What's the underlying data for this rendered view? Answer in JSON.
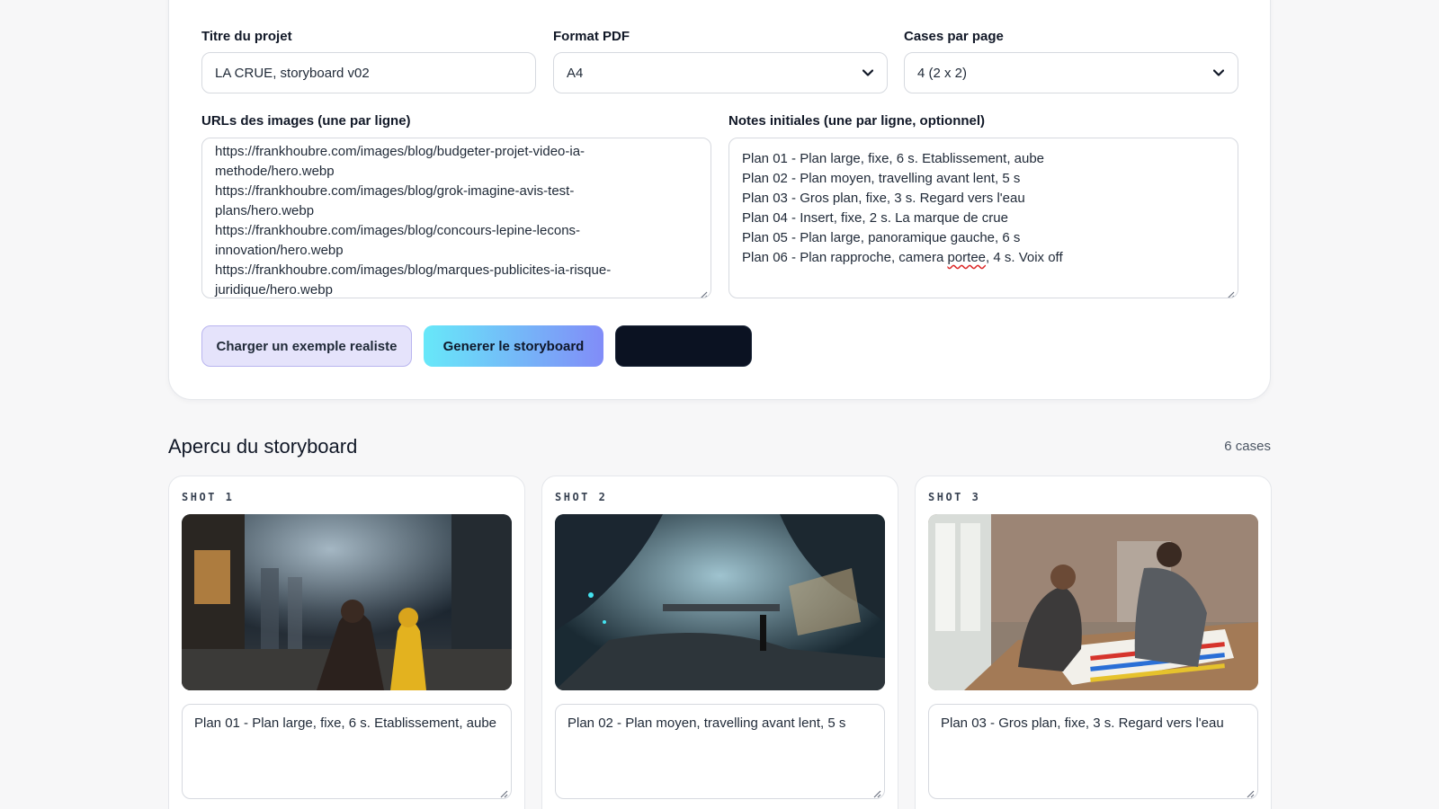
{
  "form": {
    "title_label": "Titre du projet",
    "title_value": "LA CRUE, storyboard v02",
    "format_label": "Format PDF",
    "format_value": "A4",
    "cases_label": "Cases par page",
    "cases_value": "4 (2 x 2)",
    "urls_label": "URLs des images (une par ligne)",
    "url_lines": [
      "https://frankhoubre.com/images/blog/budgeter-projet-video-ia-",
      "methode/hero.webp",
      "https://frankhoubre.com/images/blog/grok-imagine-avis-test-",
      "plans/hero.webp",
      "https://frankhoubre.com/images/blog/concours-lepine-lecons-",
      "innovation/hero.webp",
      "https://frankhoubre.com/images/blog/marques-publicites-ia-risque-",
      "juridique/hero.webp"
    ],
    "notes_label": "Notes initiales (une par ligne, optionnel)",
    "note_lines": [
      "Plan 01 - Plan large, fixe, 6 s. Etablissement, aube",
      "Plan 02 - Plan moyen, travelling avant lent, 5 s",
      "Plan 03 - Gros plan, fixe, 3 s. Regard vers l'eau",
      "Plan 04 - Insert, fixe, 2 s. La marque de crue",
      "Plan 05 - Plan large, panoramique gauche, 6 s"
    ],
    "note_line6_pre": "Plan 06 - Plan rapproche, camera ",
    "note_line6_misspelled": "portee",
    "note_line6_post": ", 4 s. Voix off"
  },
  "buttons": {
    "example_label": "Charger un exemple realiste",
    "generate_label": "Generer le storyboard"
  },
  "preview": {
    "title": "Apercu du storyboard",
    "count": "6 cases"
  },
  "shots": [
    {
      "label": "SHOT 1",
      "note": "Plan 01 - Plan large, fixe, 6 s. Etablissement, aube"
    },
    {
      "label": "SHOT 2",
      "note": "Plan 02 - Plan moyen, travelling avant lent, 5 s"
    },
    {
      "label": "SHOT 3",
      "note": "Plan 03 - Gros plan, fixe, 3 s. Regard vers l'eau"
    }
  ],
  "colors": {
    "accent_gradient_start": "#67e8f9",
    "accent_gradient_end": "#818cf8",
    "dark_button": "#0b1222",
    "example_button": "#e5e3fb"
  }
}
